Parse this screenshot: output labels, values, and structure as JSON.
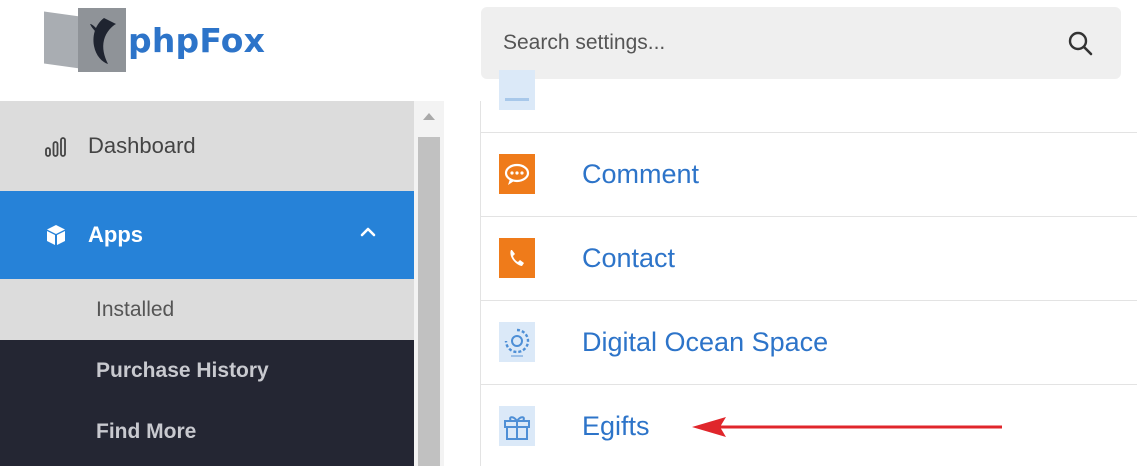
{
  "header": {
    "logo_text": "phpFox",
    "search_placeholder": "Search settings...",
    "search_icon": "search-icon"
  },
  "sidebar": {
    "dashboard_label": "Dashboard",
    "apps_label": "Apps",
    "apps_expanded": true,
    "sub_items": [
      {
        "label": "Installed",
        "active": true
      },
      {
        "label": "Purchase History"
      },
      {
        "label": "Find More"
      }
    ]
  },
  "apps": [
    {
      "name": "",
      "icon": "partial-app-icon"
    },
    {
      "name": "Comment",
      "icon": "comment-icon",
      "icon_color": "#ef7b1a"
    },
    {
      "name": "Contact",
      "icon": "phone-icon",
      "icon_color": "#ef7b1a"
    },
    {
      "name": "Digital Ocean Space",
      "icon": "digital-ocean-icon",
      "icon_color": "#dbe9f8"
    },
    {
      "name": "Egifts",
      "icon": "gift-icon",
      "icon_color": "#dbe9f8"
    }
  ],
  "colors": {
    "brand": "#2d74c9",
    "sidebar_dark": "#242633",
    "sidebar_active": "#2682d8",
    "sidebar_light": "#dcdcdc",
    "annotation_arrow": "#e0262b"
  }
}
